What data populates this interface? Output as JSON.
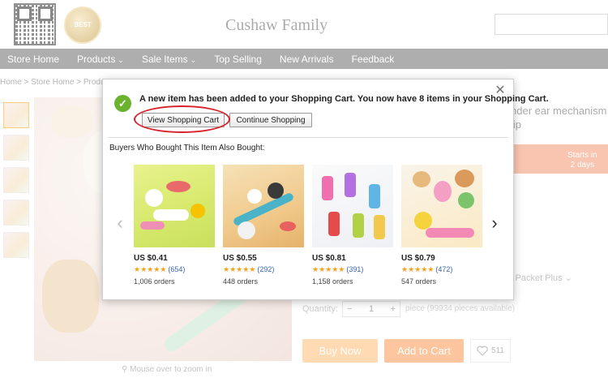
{
  "store": {
    "name": "Cushaw Family",
    "badge_text": "BEST"
  },
  "nav": {
    "items": [
      "Store Home",
      "Products",
      "Sale Items",
      "Top Selling",
      "New Arrivals",
      "Feedback"
    ]
  },
  "breadcrumb": "Home > Store Home > Products >",
  "product_page": {
    "title_line1": "nder ear mechanism",
    "title_line2": "lip",
    "promo_line1": "Starts in",
    "promo_line2": "2 days",
    "shipping_option": "l Packet Plus",
    "quantity_label": "Quantity:",
    "quantity_value": "1",
    "quantity_note": "piece (99934 pieces available)",
    "buy_now": "Buy Now",
    "add_to_cart": "Add to Cart",
    "wishlist_count": "511",
    "zoom_hint": "Mouse over to zoom in"
  },
  "dialog": {
    "message": "A new item has been added to your Shopping Cart. You now have 8 items in your Shopping Cart.",
    "view_cart": "View Shopping Cart",
    "continue_shopping": "Continue Shopping",
    "also_bought": "Buyers Who Bought This Item Also Bought:",
    "highlight_color": "#d9232c",
    "check_color": "#6bb32e"
  },
  "recommendations": [
    {
      "price": "US $0.41",
      "stars": "★★★★★",
      "reviews": "(654)",
      "orders": "1,006 orders"
    },
    {
      "price": "US $0.55",
      "stars": "★★★★★",
      "reviews": "(292)",
      "orders": "448 orders"
    },
    {
      "price": "US $0.81",
      "stars": "★★★★★",
      "reviews": "(391)",
      "orders": "1,158 orders"
    },
    {
      "price": "US $0.79",
      "stars": "★★★★★",
      "reviews": "(472)",
      "orders": "547 orders"
    }
  ],
  "icons": {
    "close": "close-icon",
    "check": "checkmark-icon",
    "prev": "chevron-left-icon",
    "next": "chevron-right-icon",
    "heart": "heart-icon"
  }
}
